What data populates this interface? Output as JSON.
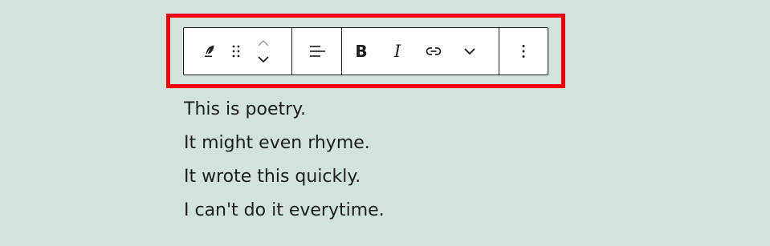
{
  "colors": {
    "background": "#d1e3dc",
    "highlight": "#ee0000",
    "toolbar_border": "#1e1e1e",
    "text": "#1e1e1e"
  },
  "toolbar": {
    "block_type_icon": "feather-icon",
    "drag_handle_icon": "drag-handle-icon",
    "move_up_icon": "chevron-up-icon",
    "move_down_icon": "chevron-down-icon",
    "align_icon": "align-left-icon",
    "bold_label": "B",
    "italic_label": "I",
    "link_icon": "link-icon",
    "more_formatting_icon": "chevron-down-icon",
    "options_icon": "more-vertical-icon"
  },
  "poem": {
    "lines": [
      "This is poetry.",
      "It might even rhyme.",
      "It wrote this quickly.",
      "I can't do it everytime."
    ]
  }
}
